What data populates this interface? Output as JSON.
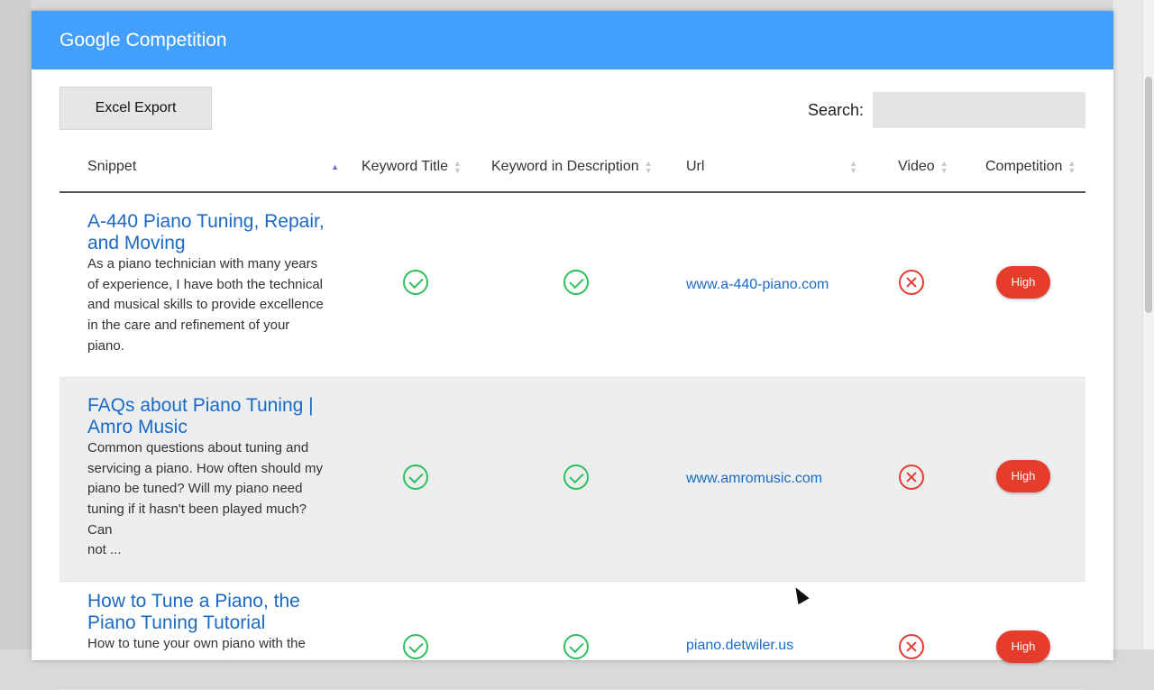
{
  "modal": {
    "title": "Google Competition"
  },
  "toolbar": {
    "export_label": "Excel Export",
    "search_label": "Search:",
    "search_value": ""
  },
  "table": {
    "columns": [
      "Snippet",
      "Keyword Title",
      "Keyword in Description",
      "Url",
      "Video",
      "Competition"
    ],
    "rows": [
      {
        "title": "A-440 Piano Tuning, Repair, and Moving",
        "description": "As a piano technician with many years of experience, I have both the technical\nand musical skills to provide excellence in the care and refinement of your piano.",
        "keyword_title": true,
        "keyword_desc": true,
        "url": "www.a-440-piano.com",
        "video": false,
        "competition": "High"
      },
      {
        "title": "FAQs about Piano Tuning | Amro Music",
        "description": "Common questions about tuning and servicing a piano. How often should my\npiano be tuned? Will my piano need tuning if it hasn't been played much? Can\nnot ...",
        "keyword_title": true,
        "keyword_desc": true,
        "url": "www.amromusic.com",
        "video": false,
        "competition": "High"
      },
      {
        "title": "How to Tune a Piano, the Piano Tuning Tutorial",
        "description": "How to tune your own piano with the",
        "keyword_title": true,
        "keyword_desc": true,
        "url": "piano.detwiler.us",
        "video": false,
        "competition": "High"
      }
    ]
  },
  "colors": {
    "header": "#42a0fc",
    "link": "#1a6ac4",
    "check": "#2ec05a",
    "cross": "#e63b2e",
    "badge": "#e53c2c"
  }
}
